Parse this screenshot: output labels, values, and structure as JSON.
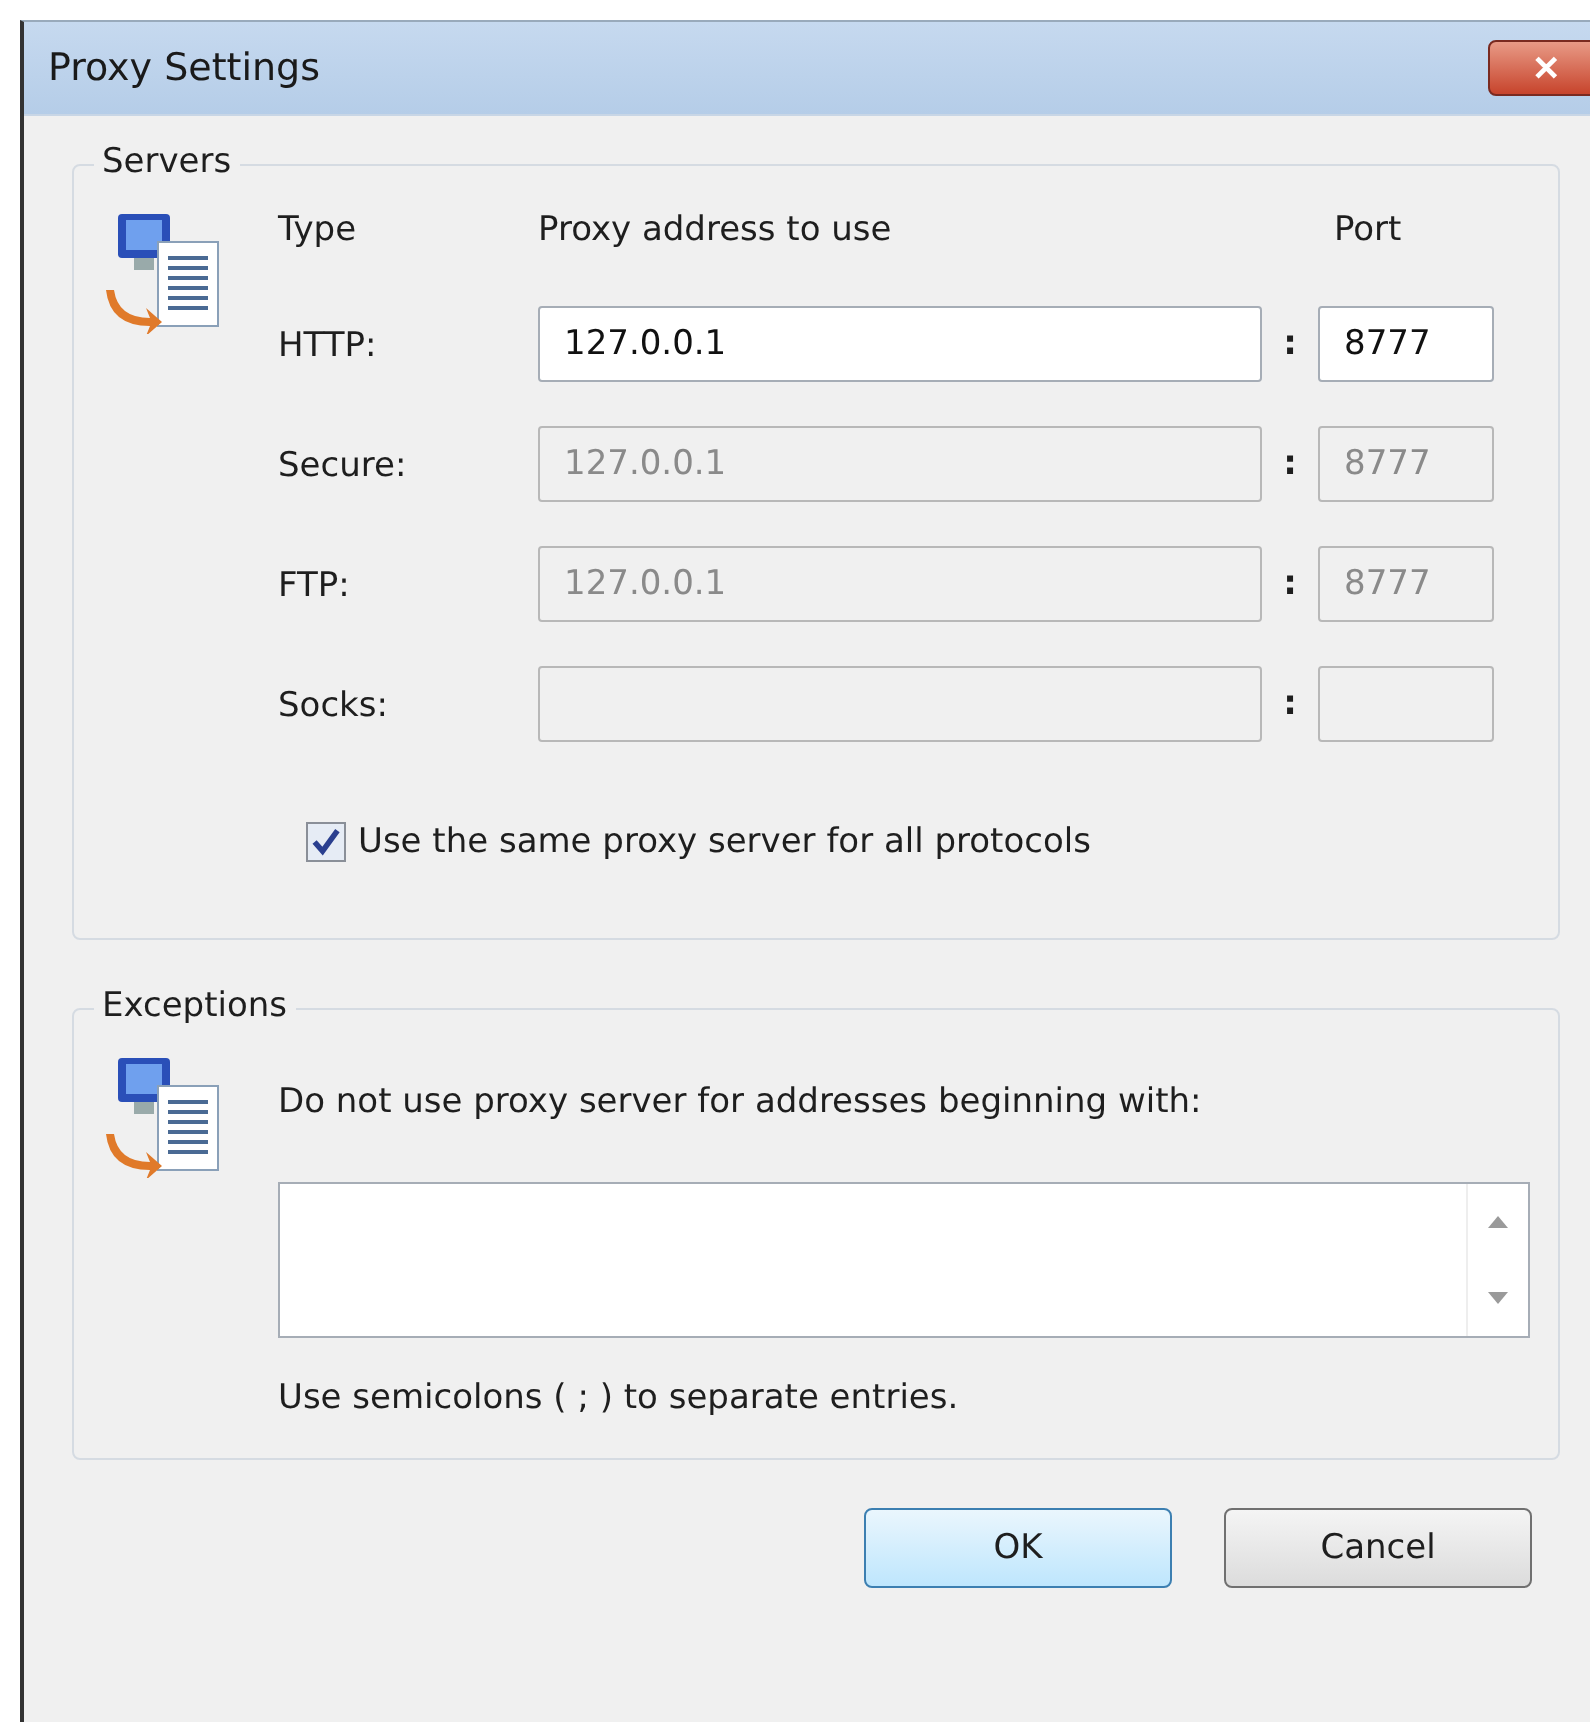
{
  "window": {
    "title": "Proxy Settings",
    "close_label": "✕"
  },
  "servers": {
    "title": "Servers",
    "columns": {
      "type": "Type",
      "address": "Proxy address to use",
      "port": "Port"
    },
    "rows": [
      {
        "label": "HTTP:",
        "address": "127.0.0.1",
        "port": "8777",
        "disabled": false
      },
      {
        "label": "Secure:",
        "address": "127.0.0.1",
        "port": "8777",
        "disabled": true
      },
      {
        "label": "FTP:",
        "address": "127.0.0.1",
        "port": "8777",
        "disabled": true
      },
      {
        "label": "Socks:",
        "disabled": true
      }
    ],
    "separator": ":",
    "same_proxy": {
      "label": "Use the same proxy server for all protocols",
      "checked": true
    }
  },
  "exceptions": {
    "title": "Exceptions",
    "description": "Do not use proxy server for addresses beginning with:",
    "hint": "Use semicolons ( ; ) to separate entries."
  },
  "buttons": [
    {
      "label": "OK",
      "default": true
    },
    {
      "label": "Cancel",
      "default": false
    }
  ]
}
